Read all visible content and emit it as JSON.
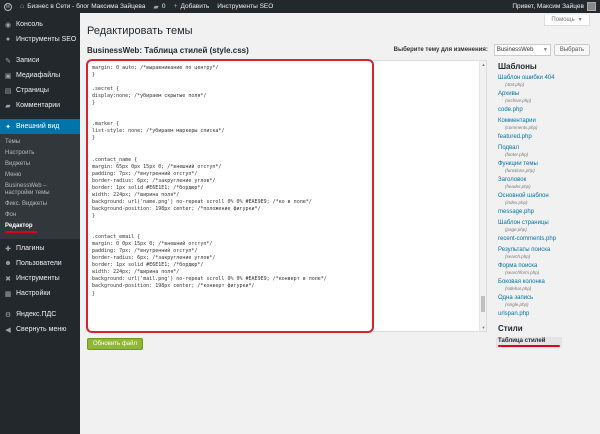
{
  "admin_bar": {
    "site_name": "Бизнес в Сети - блог Максима Зайцева",
    "comments_count": "0",
    "add_label": "Добавить",
    "seo_tools": "Инструменты SEO",
    "greeting": "Привет, Максим Зайцев"
  },
  "sidebar": {
    "items_top": [
      {
        "label": "Консоль",
        "icon": "dashboard-icon",
        "glyph": "◉"
      },
      {
        "label": "Инструменты SEO",
        "icon": "seo-icon",
        "glyph": "●"
      }
    ],
    "items_mid": [
      {
        "label": "Записи",
        "icon": "pin-icon",
        "glyph": "✎"
      },
      {
        "label": "Медиафайлы",
        "icon": "media-icon",
        "glyph": "▣"
      },
      {
        "label": "Страницы",
        "icon": "pages-icon",
        "glyph": "▤"
      },
      {
        "label": "Комментарии",
        "icon": "comments-icon",
        "glyph": "▰"
      }
    ],
    "appearance": {
      "label": "Внешний вид",
      "icon": "appearance-icon",
      "glyph": "✦"
    },
    "appearance_sub": [
      "Темы",
      "Настроить",
      "Виджеты",
      "Меню",
      "BusinessWeb – настройки темы",
      "Фикс. Виджеты",
      "Фон",
      "Редактор"
    ],
    "items_bottom": [
      {
        "label": "Плагины",
        "icon": "plugins-icon",
        "glyph": "✚"
      },
      {
        "label": "Пользователи",
        "icon": "users-icon",
        "glyph": "☻"
      },
      {
        "label": "Инструменты",
        "icon": "tools-icon",
        "glyph": "✖"
      },
      {
        "label": "Настройки",
        "icon": "settings-icon",
        "glyph": "▦"
      }
    ],
    "items_extra": [
      {
        "label": "Яндекс.ПДС",
        "icon": "yandex-icon",
        "glyph": "⚙"
      },
      {
        "label": "Свернуть меню",
        "icon": "collapse-icon",
        "glyph": "◀"
      }
    ]
  },
  "help_label": "Помощь",
  "page_title": "Редактировать темы",
  "file_title": "BusinessWeb: Таблица стилей (style.css)",
  "theme_select": {
    "label": "Выберите тему для изменения:",
    "value": "BusinessWeb",
    "button": "Выбрать"
  },
  "code_lines": [
    "margin: 0 auto; /*выравнивание по центру*/",
    "}",
    "",
    ".secret {",
    "display:none; /*убираем скрытые поля*/",
    "}",
    "",
    "",
    ".marker {",
    "list-style: none; /*убираем маркеры списка*/",
    "}",
    "",
    "",
    ".contact_name {",
    "margin: 65px 0px 15px 0; /*внешний отступ*/",
    "padding: 7px; /*внутренний отступ*/",
    "border-radius: 6px; /*закругление углов*/",
    "border: 1px solid #E6E1E1; /*бордюр*/",
    "width: 224px; /*ширина поля*/",
    "background: url('name.png') no-repeat scroll 0% 0% #EAE9E9; /*ко в поле*/",
    "background-position: 198px center; /*положение фигурки*/",
    "}",
    "",
    "",
    ".contact_email {",
    "margin: 0 0px 15px 0; /*внешний отступ*/",
    "padding: 7px; /*внутренний отступ*/",
    "border-radius: 6px; /*закругление углов*/",
    "border: 1px solid #E6E1E1; /*бордюр*/",
    "width: 224px; /*ширина поля*/",
    "background: url('mail.png') no-repeat scroll 0% 0% #EAE9E9; /*конверт в поле*/",
    "background-position: 198px center; /*конверт фигурки*/",
    "}",
    "",
    "",
    ""
  ],
  "update_button": "Обновить файл",
  "templates_heading": "Шаблоны",
  "templates": [
    {
      "label": "Шаблон ошибки 404",
      "file": "(404.php)"
    },
    {
      "label": "Архивы",
      "file": "(archive.php)"
    },
    {
      "label": "code.php",
      "file": ""
    },
    {
      "label": "Комментарии",
      "file": "(comments.php)"
    },
    {
      "label": "featured.php",
      "file": ""
    },
    {
      "label": "Подвал",
      "file": "(footer.php)"
    },
    {
      "label": "Функции темы",
      "file": "(functions.php)"
    },
    {
      "label": "Заголовок",
      "file": "(header.php)"
    },
    {
      "label": "Основной шаблон",
      "file": "(index.php)"
    },
    {
      "label": "message.php",
      "file": ""
    },
    {
      "label": "Шаблон страницы",
      "file": "(page.php)"
    },
    {
      "label": "recent-comments.php",
      "file": ""
    },
    {
      "label": "Результаты поиска",
      "file": "(search.php)"
    },
    {
      "label": "Форма поиска",
      "file": "(searchform.php)"
    },
    {
      "label": "Боковая колонка",
      "file": "(sidebar.php)"
    },
    {
      "label": "Одна запись",
      "file": "(single.php)"
    },
    {
      "label": "urlspan.php",
      "file": ""
    }
  ],
  "styles_heading": "Стили",
  "styles_current": "Таблица стилей",
  "colors": {
    "admin_bar": "#23282d",
    "active_menu": "#0073aa",
    "update_button": "#8fb634",
    "annotation_red": "#d6232c"
  }
}
